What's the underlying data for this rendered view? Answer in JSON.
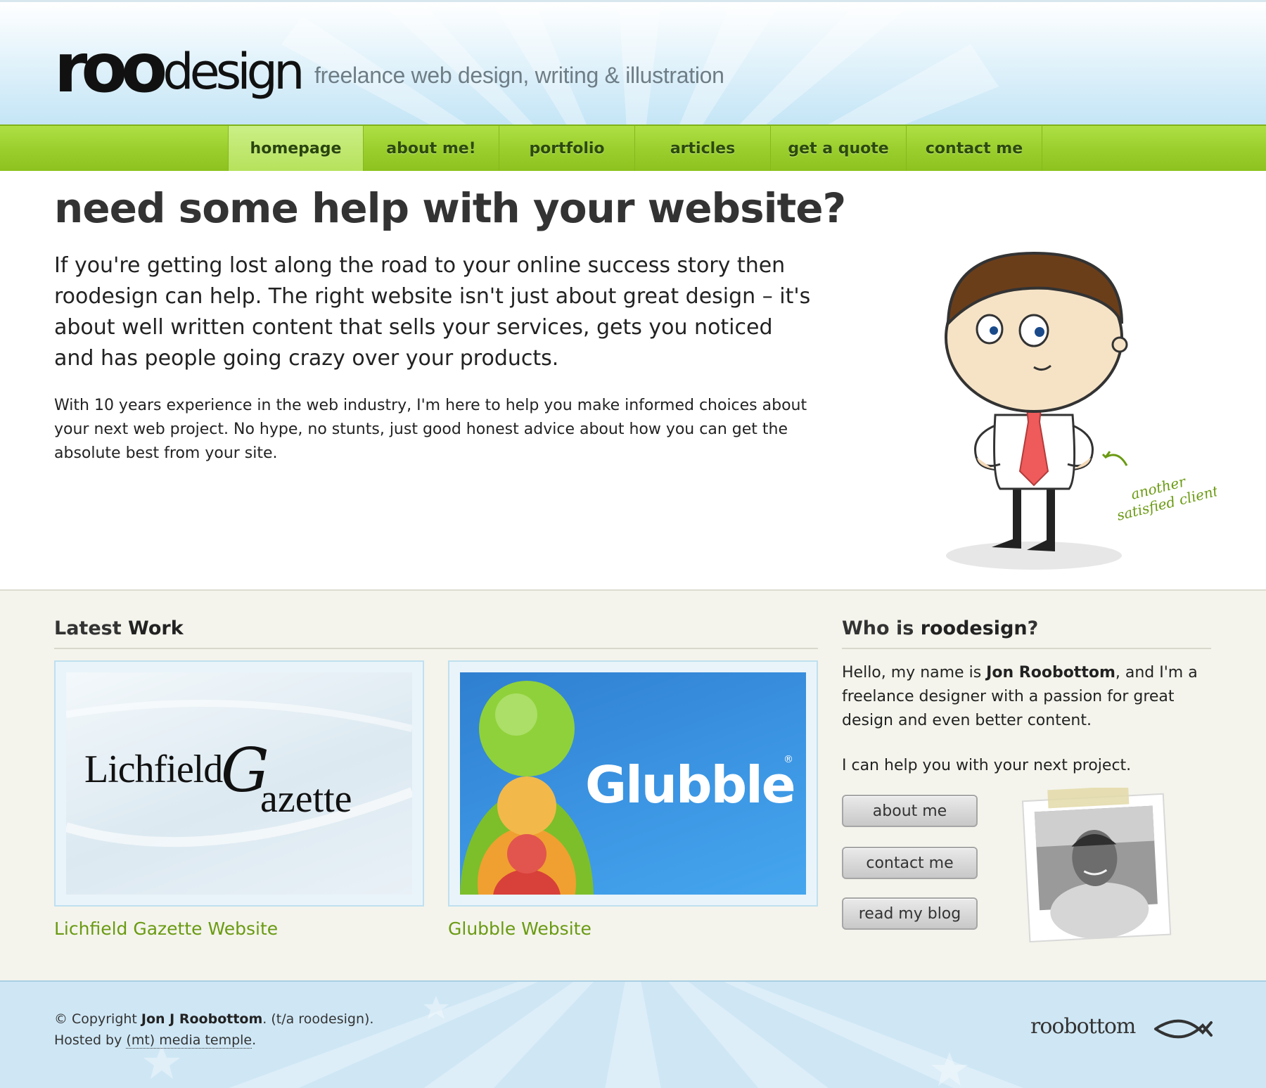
{
  "header": {
    "logo_bold": "roo",
    "logo_light": "design",
    "tagline": "freelance web design, writing & illustration"
  },
  "nav": {
    "items": [
      {
        "label": "homepage",
        "active": true
      },
      {
        "label": "about me!"
      },
      {
        "label": "portfolio"
      },
      {
        "label": "articles"
      },
      {
        "label": "get a quote"
      },
      {
        "label": "contact me"
      }
    ]
  },
  "intro": {
    "title": "need some help with your website?",
    "lead": "If you're getting lost along the road to your online success story then roodesign can help. The right website isn't just about great design – it's about well written content that sells your services, gets you noticed and has people going crazy over your products.",
    "body": "With 10 years experience in the web industry, I'm here to help you make informed choices about your next web project. No hype, no stunts, just good honest advice about how you can get the absolute best from your site.",
    "illustration_note": "another satisfied client"
  },
  "latest_work": {
    "heading_plain": "Latest ",
    "heading_bold": "Work",
    "items": [
      {
        "thumb_text_1": "Lichfield",
        "thumb_text_2": "Gazette",
        "link": "Lichfield Gazette Website"
      },
      {
        "thumb_text": "Glubble",
        "link": "Glubble Website"
      }
    ]
  },
  "who": {
    "heading_plain": "Who is ",
    "heading_bold": "roodesign",
    "heading_end": "?",
    "intro_1": "Hello, my name is ",
    "name": "Jon Roobottom",
    "intro_2": ", and I'm a freelance designer with a passion for great design and even better content.",
    "help_text": "I can help you with your next project.",
    "buttons": {
      "about": "about me",
      "contact": "contact me",
      "blog": "read my blog"
    }
  },
  "footer": {
    "copyright_1": "© Copyright ",
    "copyright_name": "Jon J Roobottom",
    "copyright_2": ". (t/a roodesign).",
    "hosted_by": "Hosted by ",
    "host_link": "(mt) media temple",
    "host_end": ".",
    "logo_text": "roobottom"
  },
  "colors": {
    "nav_green": "#9bcf2e",
    "link_green": "#6a9a12",
    "header_blue": "#c4e5f6",
    "panel_beige": "#f4f4ec"
  }
}
